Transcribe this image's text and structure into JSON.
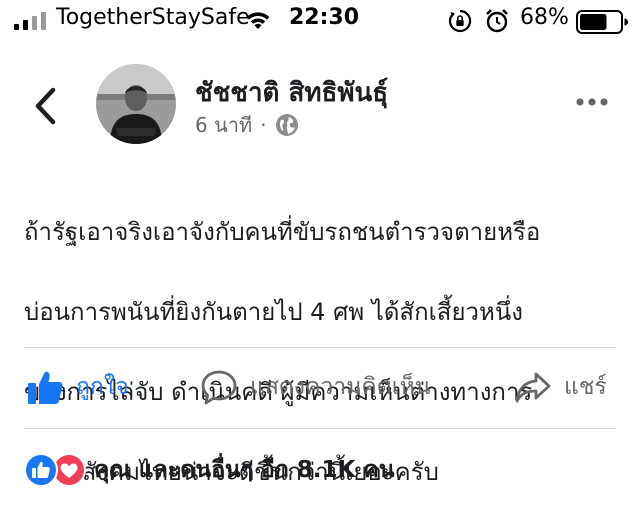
{
  "status_bar": {
    "carrier": "TogetherStaySafe",
    "time": "22:30",
    "battery": "68%",
    "battery_level": 0.68,
    "icons": [
      "signal-icon",
      "wifi-icon",
      "rotation-lock-icon",
      "alarm-icon",
      "battery-icon"
    ]
  },
  "post": {
    "author": "ชัชชาติ สิทธิพันธุ์",
    "time_ago": "6 นาที",
    "separator": "·",
    "text_lines": [
      "ถ้ารัฐเอาจริงเอาจังกับคนที่ขับรถชนตำรวจตายหรือ",
      "บ่อนการพนันที่ยิงกันตายไป 4 ศพ ได้สักเสี้ยวหนึ่ง",
      "ของการไล่จับ ดำเนินคดี ผู้มีความเห็นต่างทางการ",
      "เมือง สังคมไทยน่าจะดีขึ้นกว่านี้เยอะครับ"
    ]
  },
  "actions": {
    "like": "ถูกใจ",
    "comment": "แสดงความคิดเห็น",
    "share": "แชร์"
  },
  "reactions": {
    "summary": "คุณ และคนอื่นๆ อีก 8.1K คน"
  },
  "colors": {
    "facebook_blue": "#1877f2",
    "love_red": "#f33e58",
    "text_primary": "#1c1e21",
    "text_secondary": "#65676b"
  }
}
